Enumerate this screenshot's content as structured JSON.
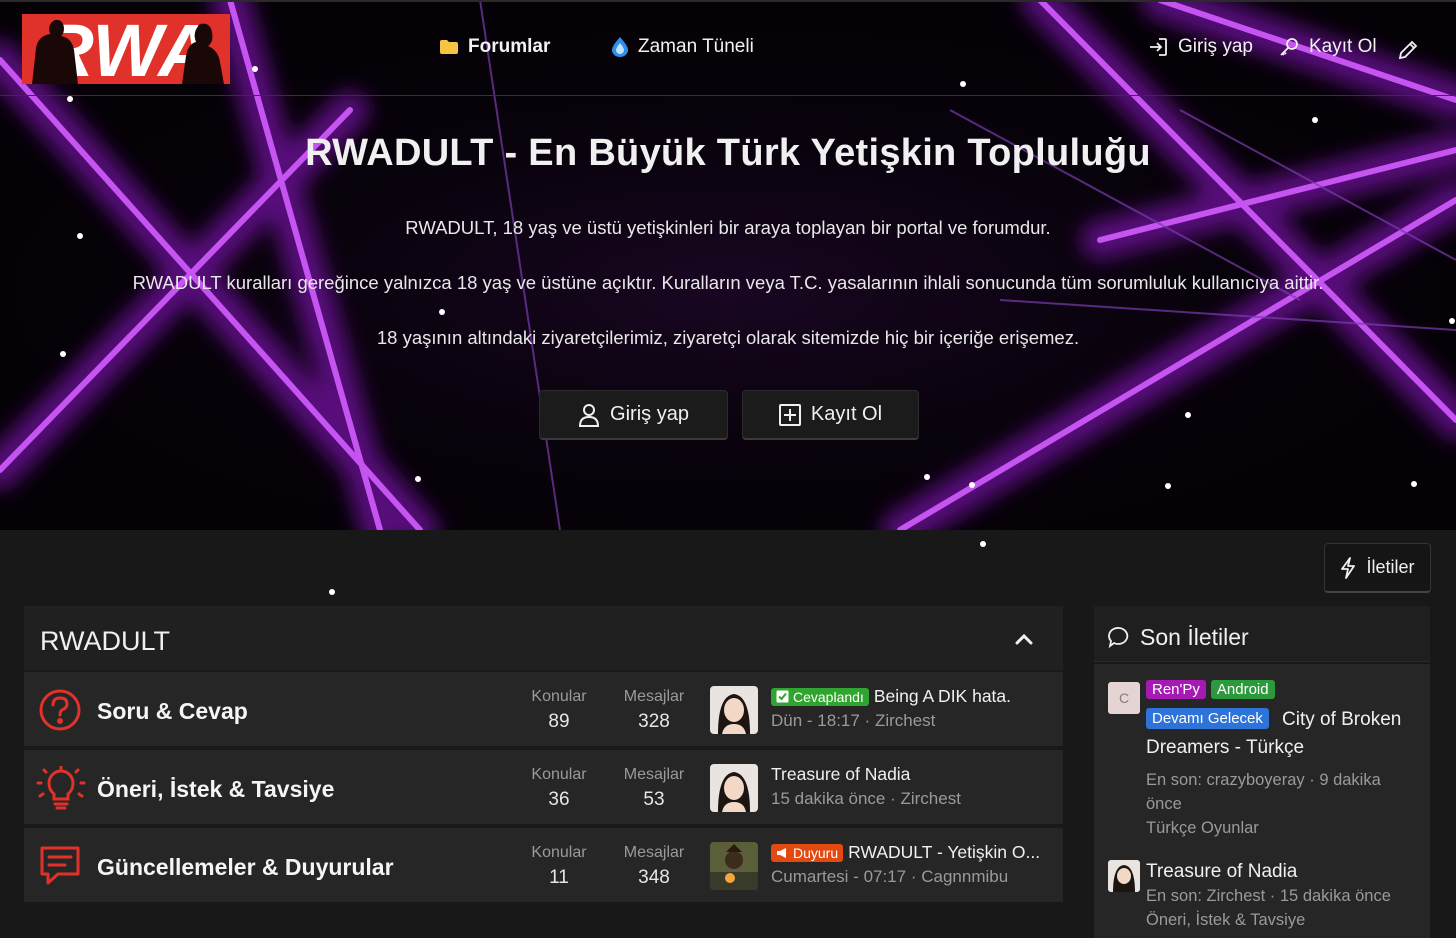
{
  "nav": {
    "forums_label": "Forumlar",
    "timeline_label": "Zaman Tüneli",
    "login_label": "Giriş yap",
    "register_label": "Kayıt Ol"
  },
  "hero": {
    "title": "RWADULT - En Büyük Türk Yetişkin Topluluğu",
    "line1": "RWADULT, 18 yaş ve üstü yetişkinleri bir araya toplayan bir portal ve forumdur.",
    "line2": "RWADULT kuralları gereğince yalnızca 18 yaş ve üstüne açıktır. Kuralların veya T.C. yasalarının ihlali sonucunda tüm sorumluluk kullanıcıya aittir.",
    "line3": "18 yaşının altındaki ziyaretçilerimiz, ziyaretçi olarak sitemizde hiç bir içeriğe erişemez.",
    "login_button": "Giriş yap",
    "register_button": "Kayıt Ol"
  },
  "iletiler_button": "İletiler",
  "category": {
    "title": "RWADULT",
    "nodes": [
      {
        "title": "Soru & Cevap",
        "threads_label": "Konular",
        "threads": "89",
        "messages_label": "Mesajlar",
        "messages": "328",
        "latest_prefix": "Cevaplandı",
        "latest_title": "Being A DIK hata.",
        "latest_meta": "Dün - 18:17 · Zirchest"
      },
      {
        "title": "Öneri, İstek & Tavsiye",
        "threads_label": "Konular",
        "threads": "36",
        "messages_label": "Mesajlar",
        "messages": "53",
        "latest_prefix": "",
        "latest_title": "Treasure of Nadia",
        "latest_meta": "15 dakika önce · Zirchest"
      },
      {
        "title": "Güncellemeler & Duyurular",
        "threads_label": "Konular",
        "threads": "11",
        "messages_label": "Mesajlar",
        "messages": "348",
        "latest_prefix": "Duyuru",
        "latest_title": "RWADULT - Yetişkin O...",
        "latest_meta": "Cumartesi - 07:17 · Cagnnmibu"
      }
    ]
  },
  "sidebar": {
    "title": "Son İletiler",
    "posts": [
      {
        "avatar_letter": "C",
        "badges": [
          "Ren'Py",
          "Android",
          "Devamı Gelecek"
        ],
        "title": "City of Broken Dreamers - Türkçe",
        "meta": "En son: crazyboyeray · 9 dakika önce",
        "forum": "Türkçe Oyunlar"
      },
      {
        "avatar_letter": "",
        "badges": [],
        "title": "Treasure of Nadia",
        "meta": "En son: Zirchest · 15 dakika önce",
        "forum": "Öneri, İstek & Tavsiye"
      }
    ]
  },
  "colors": {
    "accent_red": "#e0322a",
    "laser_purple": "#b01ee8",
    "badge_green": "#2fa52f",
    "badge_orange": "#e24a12"
  }
}
